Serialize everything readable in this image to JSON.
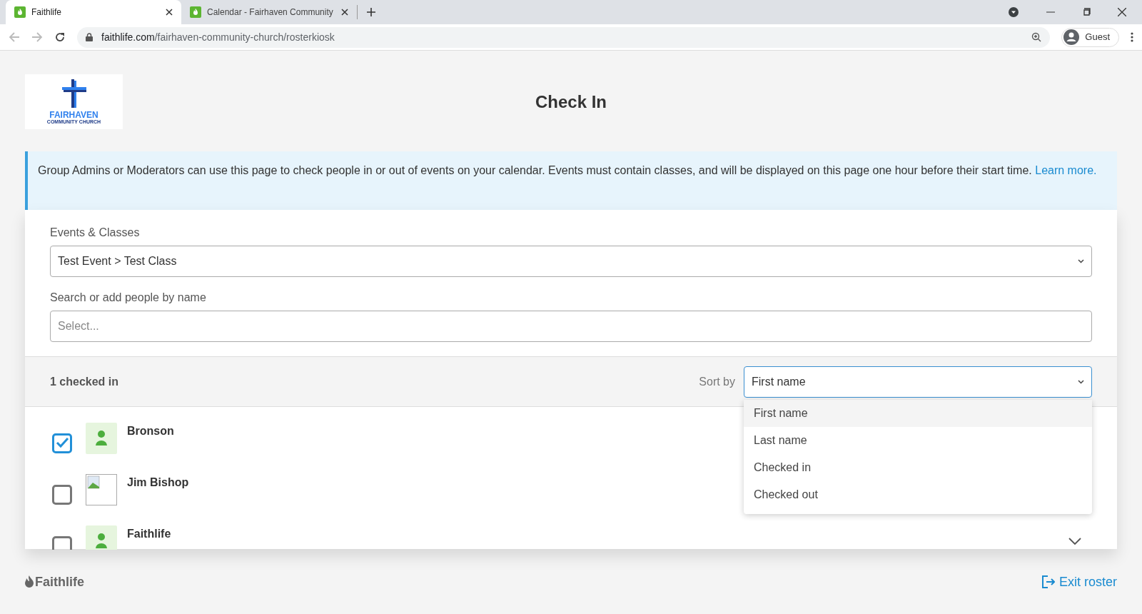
{
  "browser": {
    "tabs": [
      {
        "title": "Faithlife",
        "selected": true
      },
      {
        "title": "Calendar - Fairhaven Community",
        "selected": false
      }
    ],
    "url_host": "faithlife.com",
    "url_path": "/fairhaven-community-church/rosterkiosk",
    "profile": "Guest"
  },
  "logo": {
    "name": "FAIRHAVEN",
    "subtitle": "COMMUNITY CHURCH"
  },
  "title": "Check In",
  "notice": {
    "text": "Group Admins or Moderators can use this page to check people in or out of events on your calendar. Events must contain classes, and will be displayed on this page one hour before their start time.",
    "link": "Learn more."
  },
  "events_field": {
    "label": "Events & Classes",
    "value": "Test Event > Test Class"
  },
  "search_field": {
    "label": "Search or add people by name",
    "placeholder": "Select..."
  },
  "summary": "1 checked in",
  "sort": {
    "label": "Sort by",
    "value": "First name",
    "expanded": true,
    "options": [
      {
        "label": "First name",
        "selected": true
      },
      {
        "label": "Last name",
        "selected": false
      },
      {
        "label": "Checked in",
        "selected": false
      },
      {
        "label": "Checked out",
        "selected": false
      }
    ]
  },
  "people": [
    {
      "name": "Bronson",
      "checked": true,
      "kind": "silhouette"
    },
    {
      "name": "Jim Bishop",
      "checked": false,
      "kind": "broken"
    },
    {
      "name": "Faithlife",
      "checked": false,
      "kind": "silhouette"
    }
  ],
  "footer": {
    "brand": "Faithlife",
    "exit": "Exit roster"
  }
}
